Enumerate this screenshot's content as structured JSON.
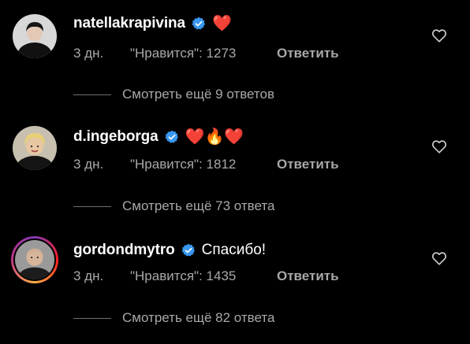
{
  "comments": [
    {
      "username": "natellakrapivina",
      "text": "",
      "emoji": "❤️",
      "time": "3 дн.",
      "likes": "\"Нравится\": 1273",
      "reply_label": "Ответить",
      "more_label": "Смотреть ещё 9 ответов"
    },
    {
      "username": "d.ingeborga",
      "text": "",
      "emoji": "❤️🔥❤️",
      "time": "3 дн.",
      "likes": "\"Нравится\": 1812",
      "reply_label": "Ответить",
      "more_label": "Смотреть ещё 73 ответа"
    },
    {
      "username": "gordondmytro",
      "text": "Спасибо!",
      "emoji": "",
      "time": "3 дн.",
      "likes": "\"Нравится\": 1435",
      "reply_label": "Ответить",
      "more_label": "Смотреть ещё 82 ответа"
    }
  ],
  "icons": {
    "verified": "verified-badge-icon",
    "like": "heart-outline-icon"
  },
  "colors": {
    "background": "#000000",
    "primary_text": "#ffffff",
    "secondary_text": "#a8a8a8",
    "verified_blue": "#3897f0",
    "heart_red": "#ed2b3f"
  }
}
